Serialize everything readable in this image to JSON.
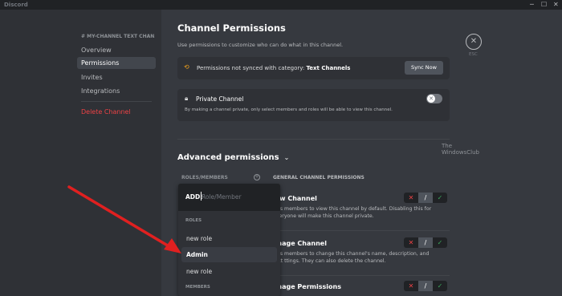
{
  "window": {
    "app_name": "Discord",
    "minimize": "─",
    "maximize": "☐",
    "close": "✕"
  },
  "sidebar": {
    "header": "# MY-CHANNEL TEXT CHAN...",
    "items": [
      {
        "label": "Overview"
      },
      {
        "label": "Permissions"
      },
      {
        "label": "Invites"
      },
      {
        "label": "Integrations"
      }
    ],
    "delete_label": "Delete Channel"
  },
  "main": {
    "title": "Channel Permissions",
    "subtitle": "Use permissions to customize who can do what in this channel.",
    "close_label": "ESC",
    "sync": {
      "text": "Permissions not synced with category: ",
      "category": "Text Channels",
      "button": "Sync Now"
    },
    "private": {
      "title": "Private Channel",
      "description": "By making a channel private, only select members and roles will be able to view this channel."
    },
    "advanced_title": "Advanced permissions",
    "watermark": [
      "The",
      "WindowsClub"
    ],
    "roles_header": "ROLES/MEMBERS",
    "perms_header": "GENERAL CHANNEL PERMISSIONS",
    "permissions": [
      {
        "name": "iew Channel",
        "desc": "ows members to view this channel by default. Disabling this for everyone will make this channel private."
      },
      {
        "name": "anage Channel",
        "desc": "ows members to change this channel's name, description, and text ttings. They can also delete the channel."
      },
      {
        "name": "anage Permissions",
        "desc": ""
      }
    ],
    "toggle_icons": {
      "deny": "✕",
      "pass": "/",
      "allow": "✓"
    }
  },
  "dropdown": {
    "add_label": "ADD:",
    "placeholder": "Role/Member",
    "roles_section": "ROLES",
    "roles": [
      "new role",
      "Admin",
      "new role"
    ],
    "members_section": "MEMBERS"
  },
  "colors": {
    "accent_red": "#ed4245",
    "arrow": "#e02020",
    "allow_green": "#3ba55c"
  }
}
